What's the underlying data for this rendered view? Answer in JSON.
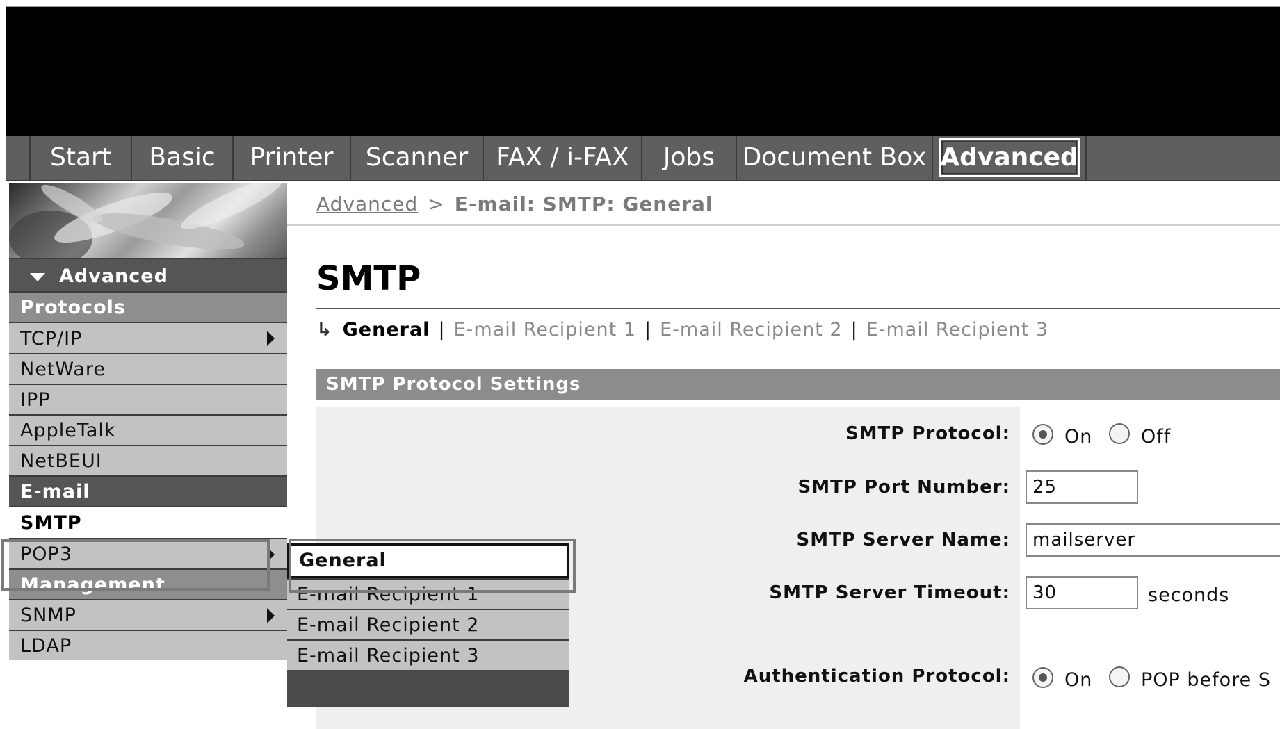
{
  "topnav": {
    "tabs": [
      {
        "label": "Start"
      },
      {
        "label": "Basic"
      },
      {
        "label": "Printer"
      },
      {
        "label": "Scanner"
      },
      {
        "label": "FAX / i-FAX"
      },
      {
        "label": "Jobs"
      },
      {
        "label": "Document Box"
      },
      {
        "label": "Advanced"
      }
    ]
  },
  "sidebar": {
    "header": "Advanced",
    "categories": {
      "protocols": "Protocols",
      "email": "E-mail",
      "management": "Management"
    },
    "items": {
      "tcpip": "TCP/IP",
      "netware": "NetWare",
      "ipp": "IPP",
      "appletalk": "AppleTalk",
      "netbeui": "NetBEUI",
      "smtp": "SMTP",
      "pop3": "POP3",
      "snmp": "SNMP",
      "ldap": "LDAP"
    }
  },
  "submenu": {
    "items": [
      "General",
      "E-mail Recipient 1",
      "E-mail Recipient 2",
      "E-mail Recipient 3"
    ]
  },
  "breadcrumb": {
    "link": "Advanced",
    "separator": ">",
    "current": "E-mail: SMTP: General"
  },
  "page": {
    "title": "SMTP",
    "subtabs": {
      "current": "General",
      "links": [
        "E-mail Recipient 1",
        "E-mail Recipient 2",
        "E-mail Recipient 3"
      ]
    },
    "section_title": "SMTP Protocol Settings"
  },
  "form": {
    "smtp_protocol": {
      "label": "SMTP Protocol:",
      "on": "On",
      "off": "Off"
    },
    "port": {
      "label": "SMTP Port Number:",
      "value": "25"
    },
    "server_name": {
      "label": "SMTP Server Name:",
      "value": "mailserver"
    },
    "timeout": {
      "label": "SMTP Server Timeout:",
      "value": "30",
      "unit": "seconds"
    },
    "auth": {
      "label": "Authentication Protocol:",
      "on": "On",
      "pop_before": "POP before S"
    }
  }
}
